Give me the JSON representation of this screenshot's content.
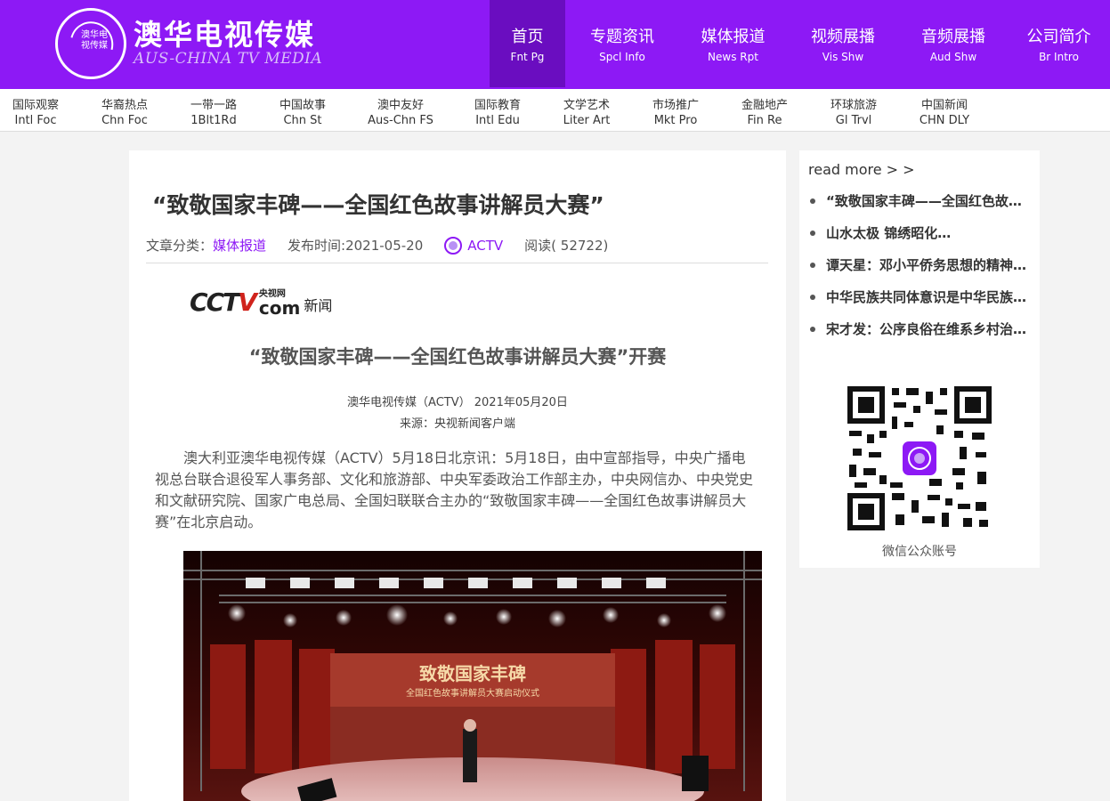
{
  "header": {
    "logo_text": "澳华电视传媒",
    "brand_cn": "澳华电视传媒",
    "brand_en": "AUS-CHINA TV MEDIA",
    "nav": [
      {
        "cn": "首页",
        "en": "Fnt Pg",
        "active": true
      },
      {
        "cn": "专题资讯",
        "en": "Spcl Info"
      },
      {
        "cn": "媒体报道",
        "en": "News Rpt"
      },
      {
        "cn": "视频展播",
        "en": "Vis Shw"
      },
      {
        "cn": "音频展播",
        "en": "Aud Shw"
      },
      {
        "cn": "公司简介",
        "en": "Br Intro"
      }
    ],
    "accent": "#8d19f5"
  },
  "subnav": [
    {
      "cn": "国际观察",
      "en": "Intl Foc"
    },
    {
      "cn": "华裔热点",
      "en": "Chn Foc"
    },
    {
      "cn": "一带一路",
      "en": "1Blt1Rd"
    },
    {
      "cn": "中国故事",
      "en": "Chn St"
    },
    {
      "cn": "澳中友好",
      "en": "Aus-Chn FS"
    },
    {
      "cn": "国际教育",
      "en": "Intl Edu"
    },
    {
      "cn": "文学艺术",
      "en": "Liter Art"
    },
    {
      "cn": "市场推广",
      "en": "Mkt Pro"
    },
    {
      "cn": "金融地产",
      "en": "Fin Re"
    },
    {
      "cn": "环球旅游",
      "en": "Gl Trvl"
    },
    {
      "cn": "中国新闻",
      "en": "CHN DLY"
    }
  ],
  "article": {
    "title": "“致敬国家丰碑——全国红色故事讲解员大赛”",
    "category_label": "文章分类：",
    "category": "媒体报道",
    "published": "发布时间:2021-05-20",
    "author": "ACTV",
    "reads": "阅读( 52722)",
    "logo_cctv": "CCTV",
    "logo_top": "央视网",
    "logo_com": "com",
    "logo_news": "新闻",
    "subtitle": "“致敬国家丰碑——全国红色故事讲解员大赛”开赛",
    "source_line1": "澳华电视传媒（ACTV） 2021年05月20日",
    "source_line2": "来源：央视新闻客户端",
    "body": "澳大利亚澳华电视传媒（ACTV）5月18日北京讯：5月18日，由中宣部指导，中央广播电视总台联合退役军人事务部、文化和旅游部、中央军委政治工作部主办，中央网信办、中央党史和文献研究院、国家广电总局、全国妇联联合主办的“致敬国家丰碑——全国红色故事讲解员大赛”在北京启动。",
    "photo_title": "致敬国家丰碑",
    "photo_subtitle": "全国红色故事讲解员大赛启动仪式"
  },
  "sidebar": {
    "read_more": "read more > >",
    "items": [
      "“致敬国家丰碑——全国红色故事讲解员大赛”",
      "山水太极 锦绣昭化…",
      "谭天星：邓小平侨务思想的精神实质",
      "中华民族共同体意识是中华民族的精神纽带",
      "宋才发：公序良俗在维系乡村治理中的作用"
    ],
    "qr_caption": "微信公众账号"
  }
}
